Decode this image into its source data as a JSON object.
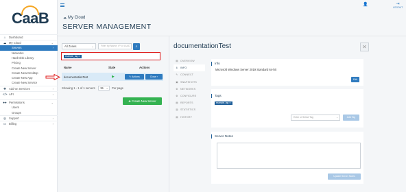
{
  "brand": {
    "logo_text": "CaaB"
  },
  "sidebar": {
    "items": [
      {
        "label": "Dashboard",
        "icon": "dashboard-icon",
        "glyph": "⌂"
      },
      {
        "label": "My Cloud",
        "icon": "cloud-icon",
        "glyph": "☁",
        "expanded": true
      },
      {
        "label": "Add-on Services",
        "icon": "puzzle-icon",
        "glyph": "✚"
      },
      {
        "label": "API",
        "icon": "code-icon",
        "glyph": "</>"
      },
      {
        "label": "Permissions",
        "icon": "users-icon",
        "glyph": "👥"
      },
      {
        "label": "Support",
        "icon": "support-icon",
        "glyph": "◎"
      },
      {
        "label": "Billing",
        "icon": "billing-icon",
        "glyph": "▭"
      }
    ],
    "cloud_sub": [
      "Servers",
      "Networks",
      "Hard Disk Library",
      "Pricing",
      "Create New Server",
      "Create New Desktop",
      "Create New App",
      "Create New Service"
    ],
    "perm_sub": [
      "Users",
      "Groups"
    ]
  },
  "topbar": {
    "logout_label": "LOGOUT"
  },
  "breadcrumb": "My Cloud",
  "page_title": "SERVER MANAGEMENT",
  "filters": {
    "zone_value": "All Zones",
    "search_placeholder": "Filter by Name, IP or UUID",
    "active_tag": "example_tag ✕"
  },
  "table": {
    "headers": [
      "Name",
      "State",
      "Actions"
    ],
    "rows": [
      {
        "name": "documentationTest",
        "state": "▶",
        "actions_label": "✎ Actions",
        "close_label": "Close ›"
      }
    ]
  },
  "pagination": {
    "summary": "Showing 1 - 1 of 1 servers",
    "per_page": "15",
    "per_page_label": "Per page"
  },
  "create_button": "✚ Create New Server",
  "detail": {
    "title": "documentationTest",
    "tabs": [
      "OVERVIEW",
      "INFO",
      "CONNECT",
      "SNAPSHOTS",
      "NETWORKS",
      "CONFIGURE",
      "REPORTS",
      "STATISTICS",
      "HISTORY"
    ],
    "tab_icons": [
      "overview-icon",
      "info-icon",
      "connect-icon",
      "snapshots-icon",
      "networks-icon",
      "configure-icon",
      "reports-icon",
      "statistics-icon",
      "history-icon"
    ],
    "tab_glyphs": [
      "▤",
      "ℹ",
      "✎",
      "▣",
      "⚙",
      "⚙",
      "▤",
      "▥",
      "▤"
    ],
    "active_tab": "INFO",
    "info": {
      "heading": "Info",
      "text": "Microsoft Windows Server 2019 Standard 64-bit",
      "edit_label": "Edit"
    },
    "tags": {
      "heading": "Tags",
      "tag": "example_tag ✕",
      "select_placeholder": "Enter or Select Tag",
      "add_label": "Add Tag"
    },
    "notes": {
      "heading": "Server Notes",
      "update_label": "Update Server Notes"
    }
  },
  "colors": {
    "brand_dark": "#1f3b52",
    "brand_orange": "#f5a623",
    "accent": "#2f7bbf",
    "success": "#34b251",
    "highlight": "#e02020"
  }
}
